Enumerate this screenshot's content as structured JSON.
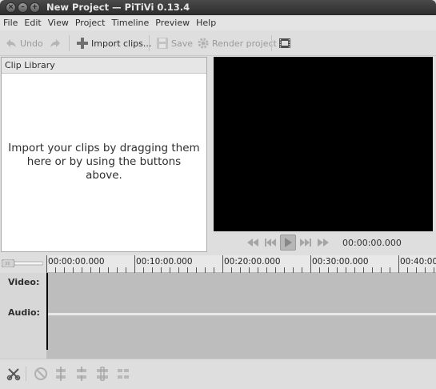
{
  "window": {
    "title": "New Project — PiTiVi 0.13.4",
    "close_glyph": "×",
    "minimize_glyph": "–",
    "maximize_glyph": "+"
  },
  "menu": [
    "File",
    "Edit",
    "View",
    "Project",
    "Timeline",
    "Preview",
    "Help"
  ],
  "toolbar": {
    "undo_label": "Undo",
    "import_label": "Import clips...",
    "save_label": "Save",
    "render_label": "Render project",
    "icons": {
      "undo": "undo-arrow-icon",
      "redo": "redo-arrow-icon",
      "import": "plus-icon",
      "save": "floppy-icon",
      "render": "gear-icon",
      "fullscreen": "film-frame-icon"
    }
  },
  "clip_library": {
    "header": "Clip Library",
    "message": "Import your clips by dragging them here or by using the buttons above."
  },
  "viewer": {
    "background": "#000000",
    "timecode": "00:00:00.000"
  },
  "timeline": {
    "ruler_labels": [
      "00:00:00.000",
      "00:10:00.000",
      "00:20:00.000",
      "00:30:00.000",
      "00:40:00."
    ],
    "tracks": [
      "Video:",
      "Audio:"
    ]
  },
  "colors": {
    "titlebar": "#3a3a3a",
    "window_bg": "#dedede",
    "track_bg": "#bdbdbd",
    "playhead": "#000000"
  }
}
